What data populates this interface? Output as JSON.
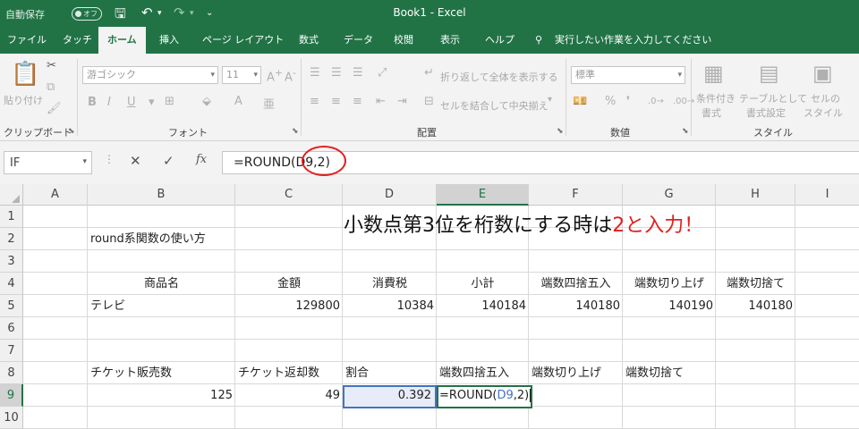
{
  "titlebar": {
    "autosave_label": "自動保存",
    "autosave_state": "オフ",
    "window_title": "Book1  -  Excel"
  },
  "tabs": [
    {
      "label": "ファイル"
    },
    {
      "label": "タッチ"
    },
    {
      "label": "ホーム",
      "active": true
    },
    {
      "label": "挿入"
    },
    {
      "label": "ページ レイアウト"
    },
    {
      "label": "数式"
    },
    {
      "label": "データ"
    },
    {
      "label": "校閲"
    },
    {
      "label": "表示"
    },
    {
      "label": "ヘルプ"
    },
    {
      "label": "実行したい作業を入力してください"
    }
  ],
  "ribbon": {
    "clipboard": {
      "paste": "貼り付け",
      "label": "クリップボード"
    },
    "font": {
      "name": "游ゴシック",
      "size": "11",
      "label": "フォント",
      "bold": "B",
      "italic": "I",
      "underline": "U"
    },
    "alignment": {
      "wrap": "折り返して全体を表示する",
      "merge": "セルを結合して中央揃え",
      "label": "配置"
    },
    "number": {
      "format": "標準",
      "label": "数値",
      "percent": "%"
    },
    "styles": {
      "conditional": "条件付き",
      "conditional_sub": "書式",
      "table": "テーブルとして",
      "table_sub": "書式設定",
      "cell": "セルの",
      "cell_sub": "スタイル",
      "label": "スタイル"
    }
  },
  "formula_bar": {
    "name_box": "IF",
    "formula_prefix": "=ROUND(",
    "formula_ref": "D9",
    "formula_suffix": ",2)",
    "cancel": "✕",
    "enter": "✓",
    "fx": "fx"
  },
  "columns": [
    "A",
    "B",
    "C",
    "D",
    "E",
    "F",
    "G",
    "H",
    "I"
  ],
  "rows": [
    "1",
    "2",
    "3",
    "4",
    "5",
    "6",
    "7",
    "8",
    "9",
    "10"
  ],
  "banner": {
    "text": "小数点第3位を桁数にする時は",
    "highlight": "2と入力！"
  },
  "cells": {
    "B2": "round系関数の使い方",
    "B4": "商品名",
    "C4": "金額",
    "D4": "消費税",
    "E4": "小計",
    "F4": "端数四捨五入",
    "G4": "端数切り上げ",
    "H4": "端数切捨て",
    "B5": "テレビ",
    "C5": "129800",
    "D5": "10384",
    "E5": "140184",
    "F5": "140180",
    "G5": "140190",
    "H5": "140180",
    "B8": "チケット販売数",
    "C8": "チケット返却数",
    "D8": "割合",
    "E8": "端数四捨五入",
    "F8": "端数切り上げ",
    "G8": "端数切捨て",
    "B9": "125",
    "C9": "49",
    "D9": "0.392"
  },
  "accent_color": "#217346",
  "annotation_color": "#e02020"
}
